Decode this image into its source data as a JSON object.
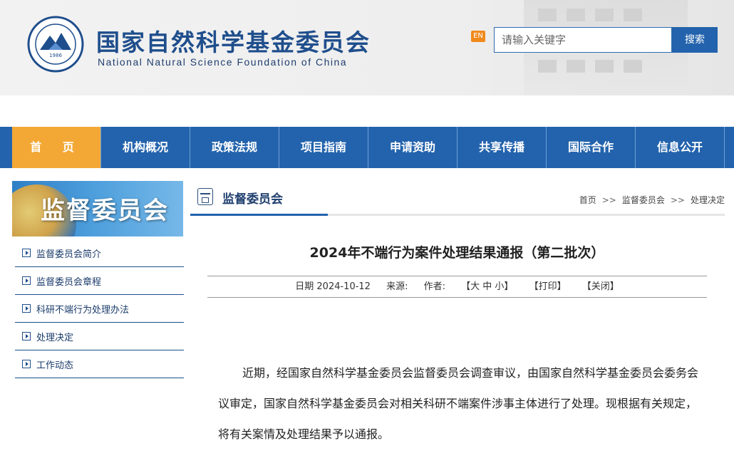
{
  "header": {
    "title": "国家自然科学基金委员会",
    "subtitle": "National Natural Science Foundation of China",
    "logo_year": "1986",
    "en_label": "EN",
    "search": {
      "placeholder": "请输入关键字",
      "button_label": "搜索"
    }
  },
  "nav": {
    "items": [
      {
        "label": "首 页",
        "active": true
      },
      {
        "label": "机构概况"
      },
      {
        "label": "政策法规"
      },
      {
        "label": "项目指南"
      },
      {
        "label": "申请资助"
      },
      {
        "label": "共享传播"
      },
      {
        "label": "国际合作"
      },
      {
        "label": "信息公开"
      }
    ]
  },
  "sidebar": {
    "banner_title": "监督委员会",
    "items": [
      {
        "label": "监督委员会简介"
      },
      {
        "label": "监督委员会章程"
      },
      {
        "label": "科研不端行为处理办法"
      },
      {
        "label": "处理决定"
      },
      {
        "label": "工作动态"
      }
    ]
  },
  "section": {
    "title": "监督委员会",
    "breadcrumb": [
      "首页",
      "监督委员会",
      "处理决定"
    ]
  },
  "article": {
    "title": "2024年不端行为案件处理结果通报（第二批次）",
    "date": "日期 2024-10-12",
    "source": "来源:",
    "author": "作者:",
    "font_size": "【大 中 小】",
    "print": "【打印】",
    "close": "【关闭】",
    "body": "近期，经国家自然科学基金委员会监督委员会调查审议，由国家自然科学基金委员会委务会议审定，国家自然科学基金委员会对相关科研不端案件涉事主体进行了处理。现根据有关规定，将有关案情及处理结果予以通报。"
  },
  "colors": {
    "primary": "#2363ad",
    "accent": "#f3a836",
    "title": "#1f4e8c"
  }
}
